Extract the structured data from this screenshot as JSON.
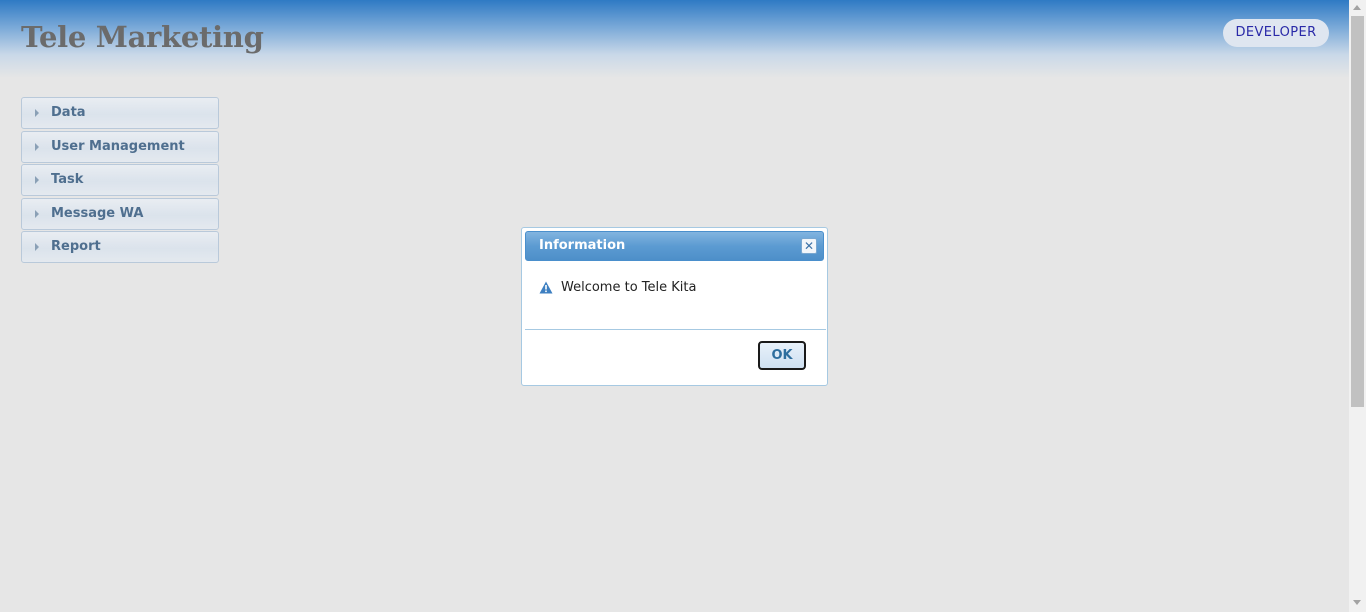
{
  "header": {
    "app_title": "Tele Marketing",
    "user_role": "DEVELOPER"
  },
  "sidebar": {
    "items": [
      {
        "label": "Data",
        "icon": "triangle-right-icon"
      },
      {
        "label": "User Management",
        "icon": "triangle-right-icon"
      },
      {
        "label": "Task",
        "icon": "triangle-right-icon"
      },
      {
        "label": "Message WA",
        "icon": "triangle-right-icon"
      },
      {
        "label": "Report",
        "icon": "triangle-right-icon"
      }
    ]
  },
  "dialog": {
    "title": "Information",
    "message": "Welcome to Tele Kita",
    "icon": "warning-icon",
    "close_icon": "close-icon",
    "ok_label": "OK"
  },
  "colors": {
    "header_top": "#2f7ac4",
    "background": "#e6e6e6",
    "title_text": "#6b6b6b",
    "role_text": "#2a2aa8",
    "nav_text": "#4f6f8f",
    "dialog_titlebar": "#5c9bd2"
  }
}
